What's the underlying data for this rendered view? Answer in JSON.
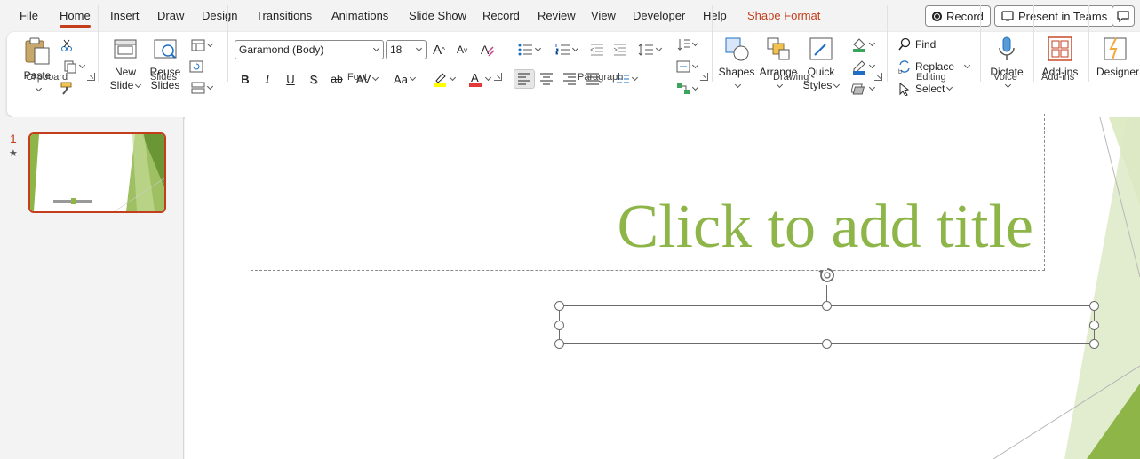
{
  "menu": {
    "tabs": [
      "File",
      "Home",
      "Insert",
      "Draw",
      "Design",
      "Transitions",
      "Animations",
      "Slide Show",
      "Record",
      "Review",
      "View",
      "Developer",
      "Help",
      "Shape Format"
    ],
    "record_button": "Record",
    "teams_button": "Present in Teams"
  },
  "ribbon": {
    "clipboard": {
      "label": "Clipboard",
      "paste": "Paste"
    },
    "slides": {
      "label": "Slides",
      "new_slide_1": "New",
      "new_slide_2": "Slide",
      "reuse_1": "Reuse",
      "reuse_2": "Slides"
    },
    "font": {
      "label": "Font",
      "font_name": "Garamond (Body)",
      "font_size": "18",
      "bold": "B",
      "italic": "I",
      "underline": "U",
      "shadow": "S",
      "strike": "ab",
      "spacing": "AV",
      "case": "Aa",
      "grow": "A",
      "shrink": "A"
    },
    "paragraph": {
      "label": "Paragraph"
    },
    "drawing": {
      "label": "Drawing",
      "shapes": "Shapes",
      "arrange": "Arrange",
      "quick_1": "Quick",
      "quick_2": "Styles"
    },
    "editing": {
      "label": "Editing",
      "find": "Find",
      "replace": "Replace",
      "select": "Select"
    },
    "voice": {
      "label": "Voice",
      "dictate": "Dictate"
    },
    "addins": {
      "label": "Add-ins",
      "addins": "Add-ins"
    },
    "designer": {
      "label": "Designer"
    }
  },
  "slides_pane": {
    "slide_number": "1",
    "star": "★"
  },
  "slide": {
    "title_placeholder": "Click to add title"
  },
  "colors": {
    "accent": "#c43e1c",
    "title_green": "#8db548"
  }
}
